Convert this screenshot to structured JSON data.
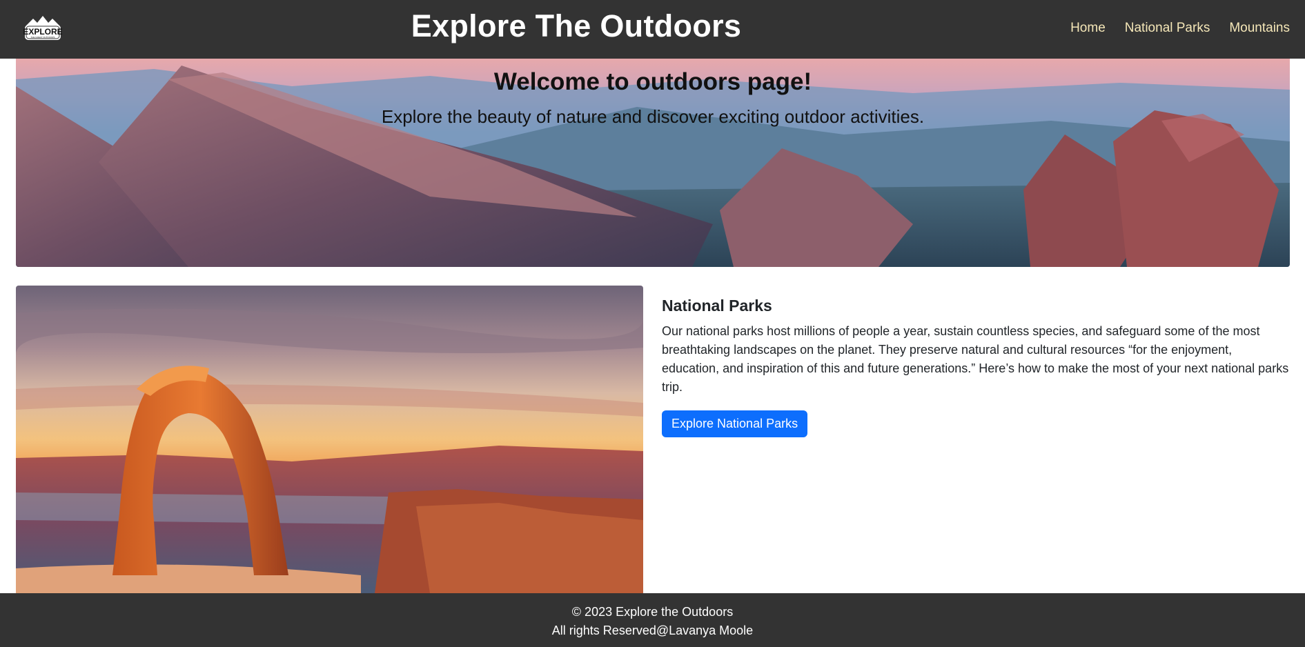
{
  "navbar": {
    "logo_text": "EXPLORE",
    "logo_tagline": "THE GREAT OUTDOORS",
    "title": "Explore The Outdoors",
    "links": [
      {
        "label": "Home"
      },
      {
        "label": "National Parks"
      },
      {
        "label": "Mountains"
      }
    ]
  },
  "hero": {
    "title": "Welcome to outdoors page!",
    "subtitle": "Explore the beauty of nature and discover exciting outdoor activities."
  },
  "card": {
    "title": "National Parks",
    "text": "Our national parks host millions of people a year, sustain countless species, and safeguard some of the most breathtaking landscapes on the planet. They preserve natural and cultural resources “for the enjoyment, education, and inspiration of this and future generations.” Here’s how to make the most of your next national parks trip.",
    "button_label": "Explore National Parks"
  },
  "footer": {
    "copyright": "© 2023 Explore the Outdoors",
    "rights": "All rights Reserved@Lavanya Moole"
  },
  "colors": {
    "nav_bg": "#333333",
    "nav_link": "#f5e7b8",
    "button_bg": "#0d6efd",
    "footer_bg": "#333333"
  }
}
